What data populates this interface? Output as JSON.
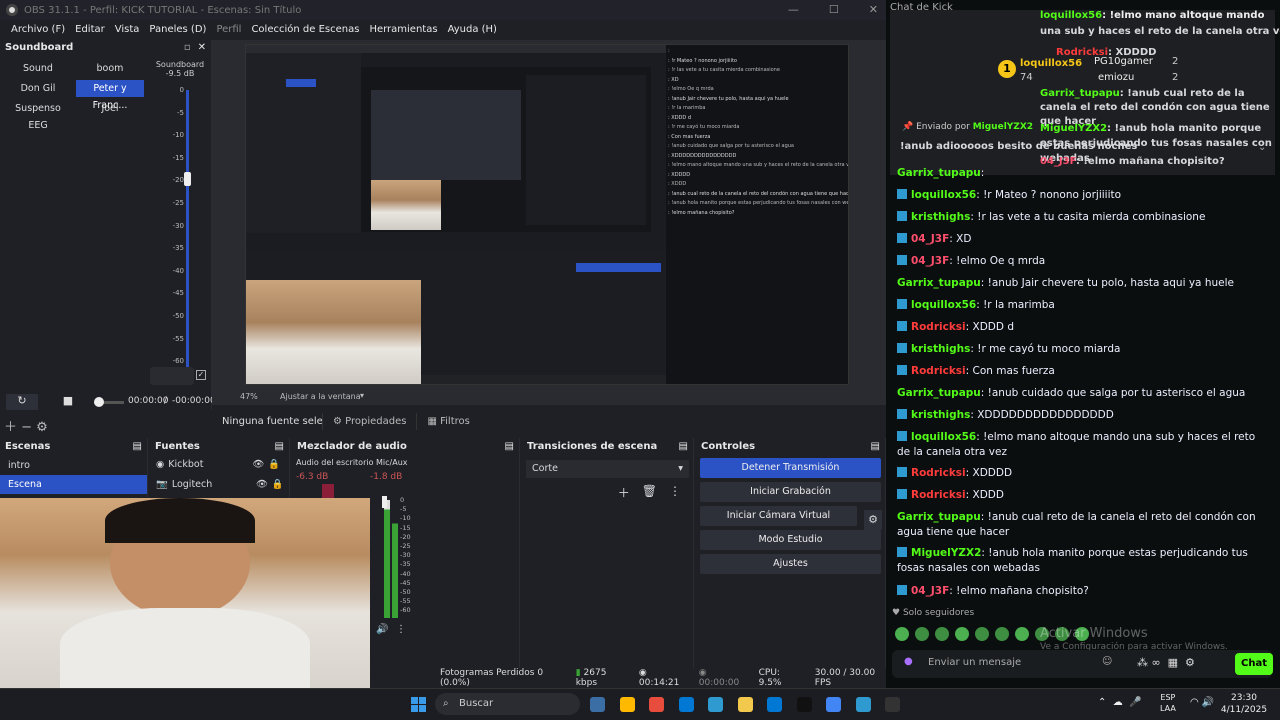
{
  "obs": {
    "title": "OBS 31.1.1 - Perfil: KICK TUTORIAL - Escenas: Sin Título",
    "menu": [
      "Archivo (F)",
      "Editar",
      "Vista",
      "Paneles (D)",
      "Perfil",
      "Colección de Escenas",
      "Herramientas",
      "Ayuda (H)"
    ],
    "soundboard": {
      "title": "Soundboard",
      "buttons": [
        "Sound",
        "boom",
        "Don Gil",
        "Peter y Franc...",
        "Suspenso EEG",
        "Joel"
      ],
      "selected": "Peter y Franc...",
      "meter_label": "Soundboard",
      "meter_db": "-9.5 dB",
      "ticks": [
        "0",
        "-5",
        "-10",
        "-15",
        "-20",
        "-25",
        "-30",
        "-35",
        "-40",
        "-45",
        "-50",
        "-55",
        "-60"
      ],
      "time_current": "00:00:00",
      "time_sep": "/",
      "time_total": "-00:00:00"
    },
    "zoom": "47%",
    "fit_label": "Ajustar a la ventana",
    "no_source": "Ninguna fuente seleccionad",
    "properties": "Propiedades",
    "filters": "Filtros",
    "scenes": {
      "title": "Escenas",
      "items": [
        "intro",
        "Escena"
      ],
      "selected": "Escena"
    },
    "sources": {
      "title": "Fuentes",
      "items": [
        "Kickbot",
        "Logitech"
      ]
    },
    "mixer": {
      "title": "Mezclador de audio",
      "channels": [
        {
          "name": "Audio del escritorio",
          "db": "-6.3 dB"
        },
        {
          "name": "Mic/Aux",
          "db": "-1.8 dB"
        }
      ],
      "ticks": [
        "0",
        "-5",
        "-10",
        "-15",
        "-20",
        "-25",
        "-30",
        "-35",
        "-40",
        "-45",
        "-50",
        "-55",
        "-60"
      ]
    },
    "transitions": {
      "title": "Transiciones de escena",
      "selected": "Corte"
    },
    "controls": {
      "title": "Controles",
      "buttons": [
        "Detener Transmisión",
        "Iniciar Grabación",
        "Iniciar Cámara Virtual",
        "Modo Estudio",
        "Ajustes"
      ]
    },
    "status": {
      "dropped": "Fotogramas Perdidos 0 (0.0%)",
      "bitrate": "2675 kbps",
      "live_time": "00:14:21",
      "rec_time": "00:00:00",
      "cpu": "CPU: 9.5%",
      "fps": "30.00 / 30.00 FPS"
    }
  },
  "chat": {
    "title": "Chat de Kick",
    "pinned": {
      "lines": [
        {
          "user": "loquillox56",
          "text": ": !elmo mano altoque mando"
        },
        {
          "user": "",
          "text": "una sub y haces el reto de la canela otra vez"
        },
        {
          "user": "Rodricksi",
          "text": ": XDDDD"
        },
        {
          "user": "loquillox56",
          "text": "74"
        },
        {
          "user": "PG10gamer",
          "text": "2"
        },
        {
          "user": "emiozu",
          "text": "2"
        },
        {
          "user": "Garrix_tupapu",
          "text": ": !anub cual reto de la canela el reto del condón con agua tiene que hacer"
        }
      ],
      "sent_by_label": "Enviado por",
      "sent_by_user": "MiguelYZX2",
      "pinned_msg_user": "MiguelYZX2",
      "pinned_msg_text": ": !anub hola manito porque estas perjudicando tus fosas nasales con webadas",
      "tail_user": "04_J3F",
      "tail_text": ": !elmo mañana chopisito?",
      "extra": "!anub adiooooos besito de buenas noches"
    },
    "messages": [
      {
        "user": "Garrix_tupapu",
        "text": ":",
        "color": "#53fc18"
      },
      {
        "user": "loquillox56",
        "text": ": !r Mateo ? nonono jorjiiiito",
        "color": "#53fc18"
      },
      {
        "user": "kristhighs",
        "text": ": !r las vete a tu casita mierda combinasione",
        "color": "#53fc18"
      },
      {
        "user": "04_J3F",
        "text": ": XD",
        "color": "#ff4f6d"
      },
      {
        "user": "04_J3F",
        "text": ": !elmo Oe q mrda",
        "color": "#ff4f6d"
      },
      {
        "user": "Garrix_tupapu",
        "text": ": !anub Jair chevere tu polo, hasta aqui ya huele",
        "color": "#53fc18"
      },
      {
        "user": "loquillox56",
        "text": ": !r la marimba",
        "color": "#53fc18"
      },
      {
        "user": "Rodricksi",
        "text": ": XDDD d",
        "color": "#ff3b3b"
      },
      {
        "user": "kristhighs",
        "text": ": !r me cayó tu moco miarda",
        "color": "#53fc18"
      },
      {
        "user": "Rodricksi",
        "text": ": Con mas fuerza",
        "color": "#ff3b3b"
      },
      {
        "user": "Garrix_tupapu",
        "text": ": !anub cuidado que salga por tu asterisco el agua",
        "color": "#53fc18"
      },
      {
        "user": "kristhighs",
        "text": ": XDDDDDDDDDDDDDDDD",
        "color": "#53fc18"
      },
      {
        "user": "loquillox56",
        "text": ": !elmo mano altoque mando una sub y haces el reto de la canela otra vez",
        "color": "#53fc18"
      },
      {
        "user": "Rodricksi",
        "text": ": XDDDD",
        "color": "#ff3b3b"
      },
      {
        "user": "Rodricksi",
        "text": ": XDDD",
        "color": "#ff3b3b"
      },
      {
        "user": "Garrix_tupapu",
        "text": ": !anub cual reto de la canela el reto del condón con agua tiene que hacer",
        "color": "#53fc18"
      },
      {
        "user": "MiguelYZX2",
        "text": ": !anub hola manito porque estas perjudicando tus fosas nasales con webadas",
        "color": "#53fc18"
      },
      {
        "user": "04_J3F",
        "text": ": !elmo mañana chopisito?",
        "color": "#ff4f6d"
      }
    ],
    "followers_only": "Solo seguidores",
    "placeholder": "Enviar un mensaje",
    "send": "Chat",
    "watermark1": "Activar Windows",
    "watermark2": "Ve a Configuración para activar Windows."
  },
  "taskbar": {
    "search": "Buscar",
    "lang1": "ESP",
    "lang2": "LAA",
    "time": "23:30",
    "date": "4/11/2025"
  },
  "colors": {
    "accent": "#2c53c6",
    "kick_green": "#53fc18",
    "bg": "#1f2026"
  }
}
